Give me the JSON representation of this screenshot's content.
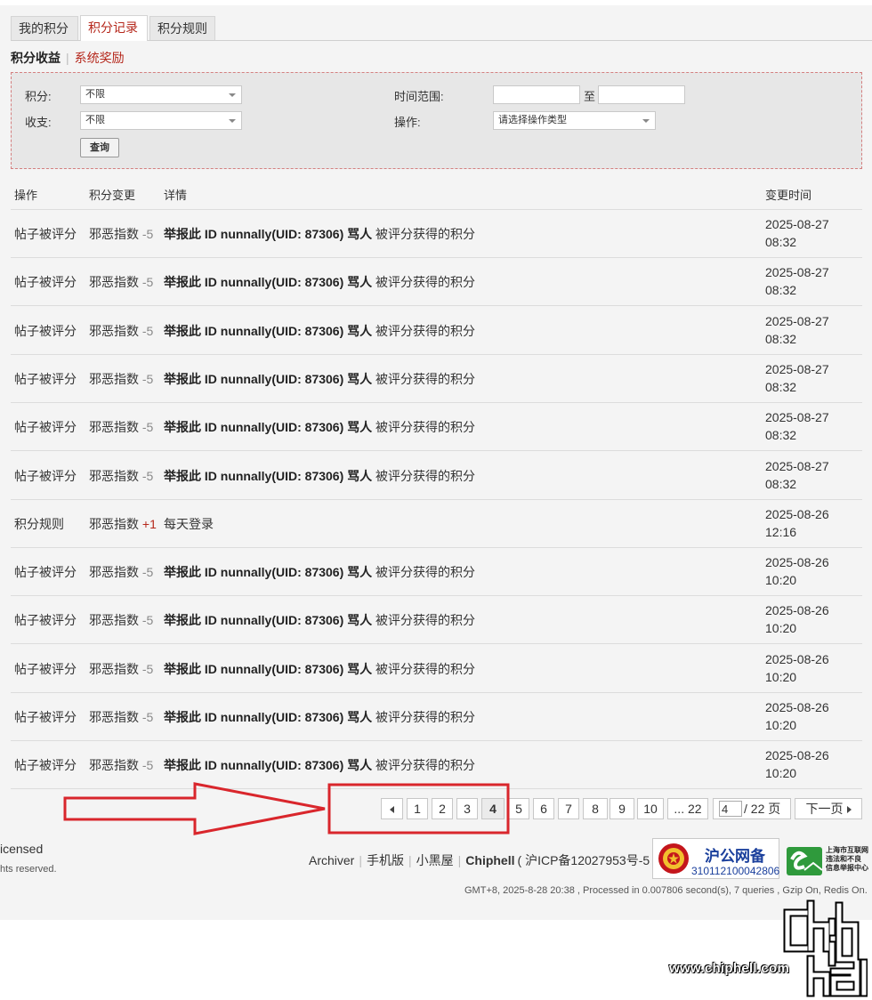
{
  "tabs": [
    "我的积分",
    "积分记录",
    "积分规则"
  ],
  "subnav": {
    "current": "积分收益",
    "other": "系统奖励"
  },
  "filter": {
    "credit_label": "积分:",
    "credit_value": "不限",
    "io_label": "收支:",
    "io_value": "不限",
    "time_label": "时间范围:",
    "time_sep": "至",
    "op_label": "操作:",
    "op_placeholder": "请选择操作类型",
    "query_button": "查询"
  },
  "table": {
    "headers": [
      "操作",
      "积分变更",
      "详情",
      "变更时间"
    ],
    "rows": [
      {
        "op": "帖子被评分",
        "credit": "邪恶指数",
        "delta": "-5",
        "sign": "neg",
        "detail_bold": "举报此 ID nunnally(UID: 87306) 骂人",
        "detail": "被评分获得的积分",
        "date": "2025-08-27",
        "time": "08:32"
      },
      {
        "op": "帖子被评分",
        "credit": "邪恶指数",
        "delta": "-5",
        "sign": "neg",
        "detail_bold": "举报此 ID nunnally(UID: 87306) 骂人",
        "detail": "被评分获得的积分",
        "date": "2025-08-27",
        "time": "08:32"
      },
      {
        "op": "帖子被评分",
        "credit": "邪恶指数",
        "delta": "-5",
        "sign": "neg",
        "detail_bold": "举报此 ID nunnally(UID: 87306) 骂人",
        "detail": "被评分获得的积分",
        "date": "2025-08-27",
        "time": "08:32"
      },
      {
        "op": "帖子被评分",
        "credit": "邪恶指数",
        "delta": "-5",
        "sign": "neg",
        "detail_bold": "举报此 ID nunnally(UID: 87306) 骂人",
        "detail": "被评分获得的积分",
        "date": "2025-08-27",
        "time": "08:32"
      },
      {
        "op": "帖子被评分",
        "credit": "邪恶指数",
        "delta": "-5",
        "sign": "neg",
        "detail_bold": "举报此 ID nunnally(UID: 87306) 骂人",
        "detail": "被评分获得的积分",
        "date": "2025-08-27",
        "time": "08:32"
      },
      {
        "op": "帖子被评分",
        "credit": "邪恶指数",
        "delta": "-5",
        "sign": "neg",
        "detail_bold": "举报此 ID nunnally(UID: 87306) 骂人",
        "detail": "被评分获得的积分",
        "date": "2025-08-27",
        "time": "08:32"
      },
      {
        "op": "积分规则",
        "credit": "邪恶指数",
        "delta": "+1",
        "sign": "pos",
        "detail_bold": "",
        "detail": "每天登录",
        "date": "2025-08-26",
        "time": "12:16"
      },
      {
        "op": "帖子被评分",
        "credit": "邪恶指数",
        "delta": "-5",
        "sign": "neg",
        "detail_bold": "举报此 ID nunnally(UID: 87306) 骂人",
        "detail": "被评分获得的积分",
        "date": "2025-08-26",
        "time": "10:20"
      },
      {
        "op": "帖子被评分",
        "credit": "邪恶指数",
        "delta": "-5",
        "sign": "neg",
        "detail_bold": "举报此 ID nunnally(UID: 87306) 骂人",
        "detail": "被评分获得的积分",
        "date": "2025-08-26",
        "time": "10:20"
      },
      {
        "op": "帖子被评分",
        "credit": "邪恶指数",
        "delta": "-5",
        "sign": "neg",
        "detail_bold": "举报此 ID nunnally(UID: 87306) 骂人",
        "detail": "被评分获得的积分",
        "date": "2025-08-26",
        "time": "10:20"
      },
      {
        "op": "帖子被评分",
        "credit": "邪恶指数",
        "delta": "-5",
        "sign": "neg",
        "detail_bold": "举报此 ID nunnally(UID: 87306) 骂人",
        "detail": "被评分获得的积分",
        "date": "2025-08-26",
        "time": "10:20"
      },
      {
        "op": "帖子被评分",
        "credit": "邪恶指数",
        "delta": "-5",
        "sign": "neg",
        "detail_bold": "举报此 ID nunnally(UID: 87306) 骂人",
        "detail": "被评分获得的积分",
        "date": "2025-08-26",
        "time": "10:20"
      }
    ]
  },
  "pager": {
    "pages": [
      "1",
      "2",
      "3",
      "4",
      "5",
      "6",
      "7",
      "8",
      "9",
      "10",
      "... 22"
    ],
    "current": "4",
    "input_value": "4",
    "total": "/ 22 页",
    "next": "下一页"
  },
  "footer": {
    "license_partial": "icensed",
    "rights_partial": "hts reserved.",
    "links": [
      "Archiver",
      "手机版",
      "小黑屋"
    ],
    "brand": "Chiphell",
    "icp": "( 沪ICP备12027953号-5 )",
    "gmt": "GMT+8, 2025-8-28 20:38 , Processed in 0.007806 second(s), 7 queries , Gzip On, Redis On.",
    "badge_title": "沪公网备",
    "badge_number": "310112100042806",
    "badge2_lines": [
      "上海市互联网",
      "违法和不良",
      "信息举报中心"
    ],
    "watermark": "www.chiphell.com"
  },
  "colors": {
    "accent": "#b5271b",
    "annotation": "#d9262c"
  }
}
